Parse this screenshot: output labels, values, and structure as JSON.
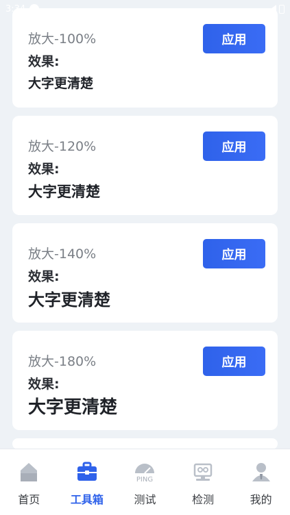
{
  "status": {
    "time": "3:34"
  },
  "cards": [
    {
      "title": "放大-100%",
      "effect_label": "效果:",
      "sample": "大字更清楚",
      "apply_label": "应用"
    },
    {
      "title": "放大-120%",
      "effect_label": "效果:",
      "sample": "大字更清楚",
      "apply_label": "应用"
    },
    {
      "title": "放大-140%",
      "effect_label": "效果:",
      "sample": "大字更清楚",
      "apply_label": "应用"
    },
    {
      "title": "放大-180%",
      "effect_label": "效果:",
      "sample": "大字更清楚",
      "apply_label": "应用"
    }
  ],
  "tabs": [
    {
      "label": "首页",
      "icon": "home-icon"
    },
    {
      "label": "工具箱",
      "icon": "toolbox-icon",
      "active": true
    },
    {
      "label": "测试",
      "icon": "ping-icon",
      "icon_text": "PING"
    },
    {
      "label": "检测",
      "icon": "monitor-icon"
    },
    {
      "label": "我的",
      "icon": "profile-icon"
    }
  ],
  "colors": {
    "accent": "#2f62ea",
    "background": "#eef2f6",
    "icon_gray": "#b9bfc8"
  }
}
